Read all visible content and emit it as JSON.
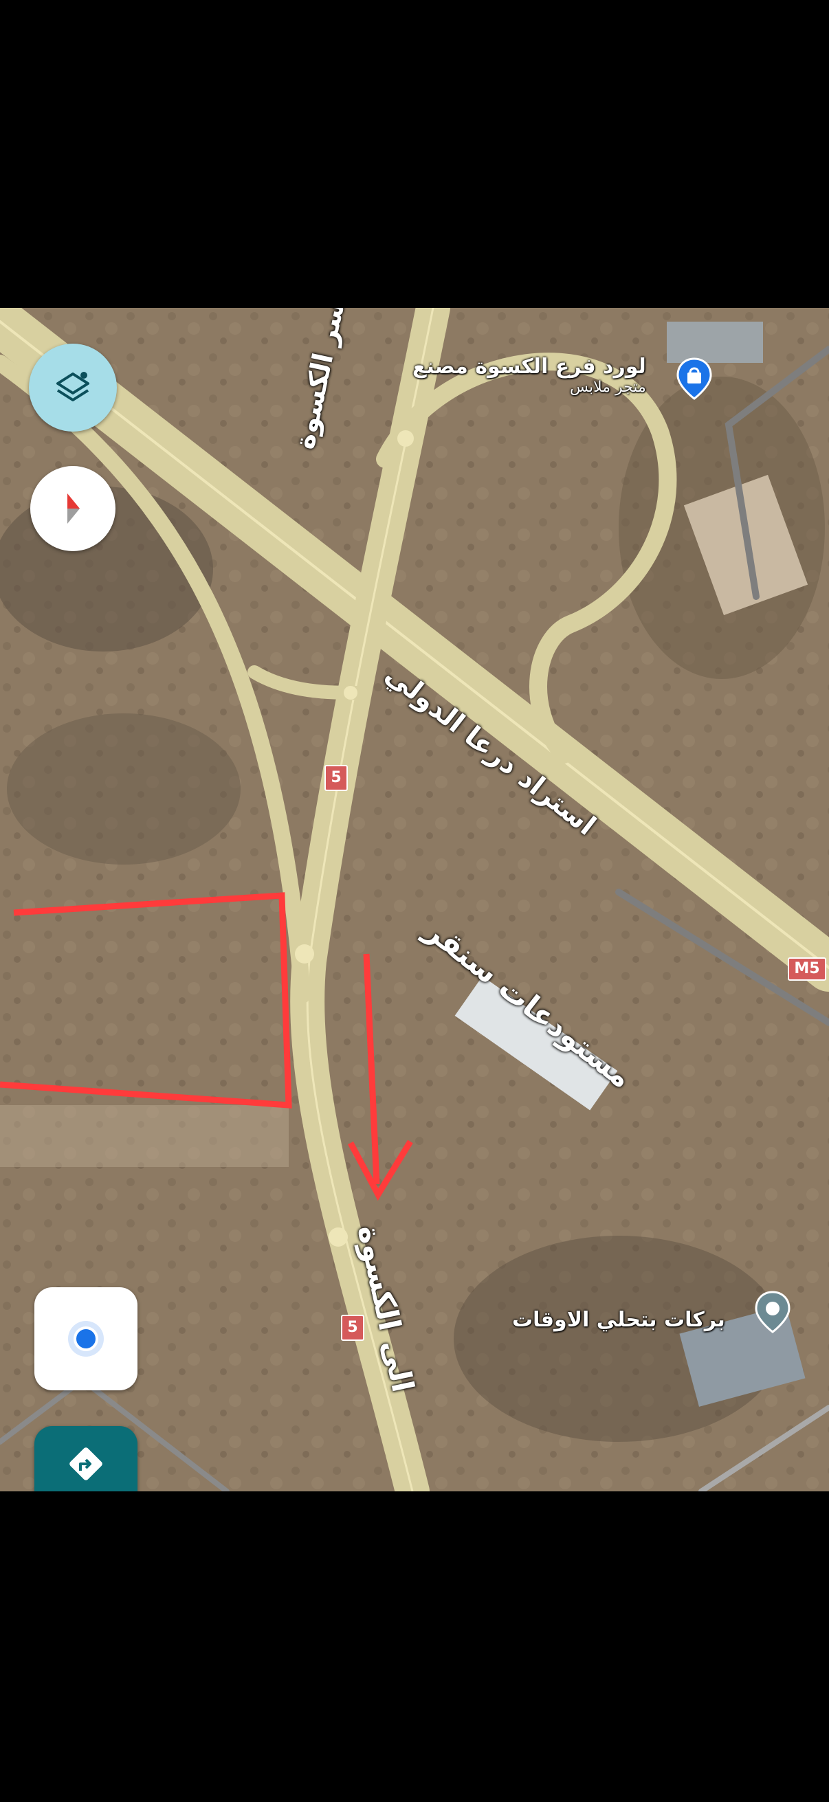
{
  "map": {
    "pois": [
      {
        "name": "لورد فرع الكسوة مصنع",
        "category": "متجر ملابس",
        "icon": "shopping-bag-icon"
      },
      {
        "name": "بركات بتحلي الاوقات",
        "icon": "place-pin-icon"
      }
    ],
    "road_labels": {
      "bridge": "جسر الكسوة",
      "highway": "استراد درعا الدولي",
      "warehouses": "مستودعات سنقر",
      "to_kiswah": "الى الكسوة"
    },
    "shields": {
      "route_5_top": "5",
      "route_5_bottom": "5",
      "m5": "M5"
    }
  },
  "controls": {
    "layers": "layers-icon",
    "compass": "compass-icon",
    "my_location": "my-location-icon",
    "directions": "directions-icon"
  },
  "colors": {
    "road": "#d8d0a0",
    "annotation": "#ff3b3b",
    "control_accent": "#1a73e8",
    "directions_button": "#0b6e77"
  }
}
